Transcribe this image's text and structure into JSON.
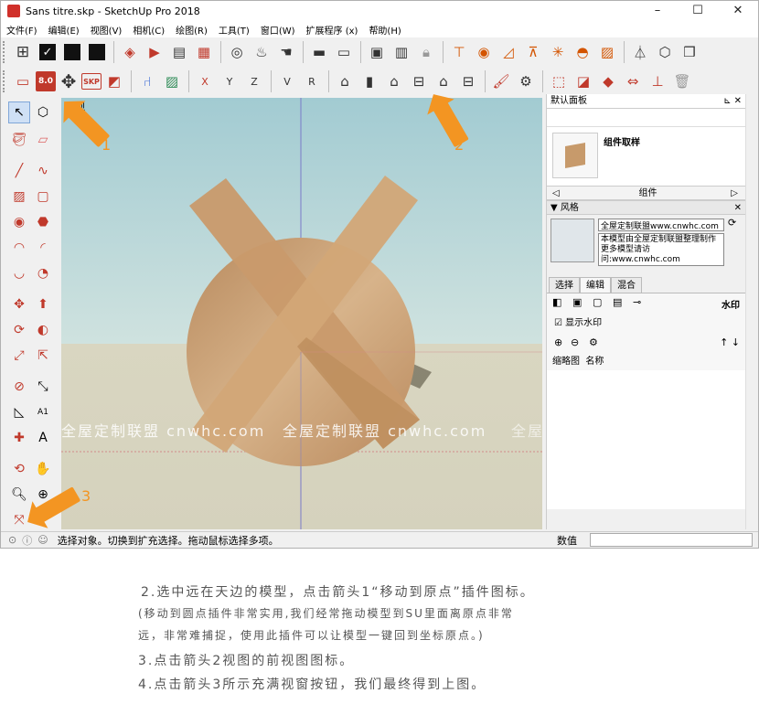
{
  "window": {
    "title": "Sans titre.skp - SketchUp Pro 2018",
    "minimize": "–",
    "maximize": "☐",
    "close": "✕"
  },
  "menu": [
    "文件(F)",
    "编辑(E)",
    "视图(V)",
    "相机(C)",
    "绘图(R)",
    "工具(T)",
    "窗口(W)",
    "扩展程序 (x)",
    "帮助(H)"
  ],
  "toolbar": {
    "badge_label": "8.0",
    "skp_label": "SKP",
    "axis_labels": [
      "X",
      "Y",
      "Z",
      "V",
      "R"
    ]
  },
  "viewport": {
    "view_label": "前视",
    "watermarks": [
      "全屋定制联盟 cnwhc.com",
      "全屋定制联盟 cnwhc.com",
      "全屋定制联盟 cnwhc.com"
    ]
  },
  "panel": {
    "title": "默认面板",
    "component_name": "组件取样",
    "components_section": "组件",
    "styles_section": "风格",
    "style_name": "全屋定制联盟www.cnwhc.com",
    "style_desc": "本模型由全屋定制联盟整理制作更多模型请访问:www.cnwhc.com",
    "tabs": [
      "选择",
      "编辑",
      "混合"
    ],
    "watermark_label": "水印",
    "show_watermark": "显示水印",
    "col_thumb": "缩略图",
    "col_name": "名称"
  },
  "status": {
    "message": "选择对象。切换到扩充选择。拖动鼠标选择多项。",
    "value_label": "数值"
  },
  "annotations": {
    "arrow1": "1",
    "arrow2": "2",
    "arrow3": "3"
  },
  "caption": {
    "line1": "2.选中远在天边的模型，点击箭头1“移动到原点”插件图标。",
    "line2": "(移动到圆点插件非常实用,我们经常拖动模型到SU里面离原点非常",
    "line3": "远，非常难捕捉，使用此插件可以让模型一键回到坐标原点。)",
    "line4": "3.点击箭头2视图的前视图图标。",
    "line5": "4.点击箭头3所示充满视窗按钮，我们最终得到上图。"
  },
  "colors": {
    "accent": "#f39522",
    "wood": "#c8a077",
    "sky": "#a2cbd2",
    "ground": "#d5d2bd"
  }
}
